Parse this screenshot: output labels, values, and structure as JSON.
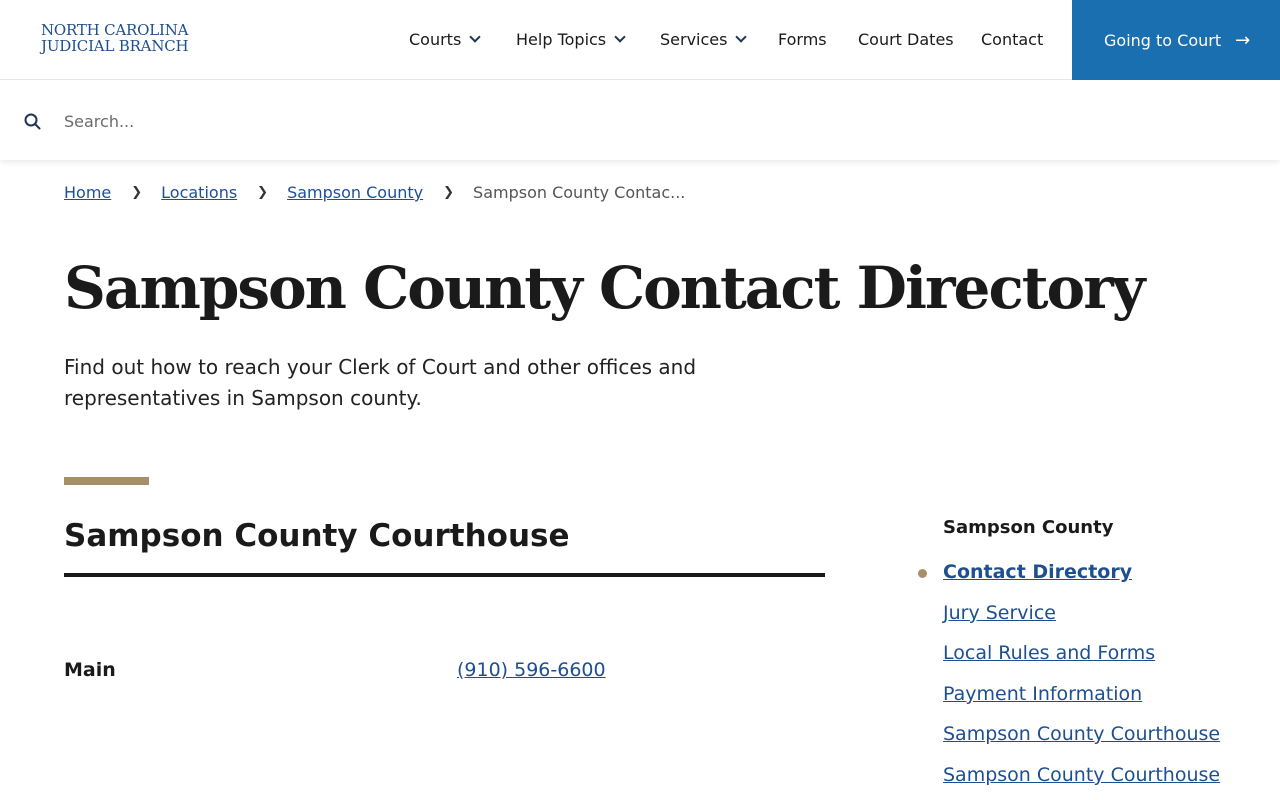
{
  "header": {
    "logo_line1": "NORTH CAROLINA",
    "logo_line2": "JUDICIAL BRANCH",
    "nav": [
      {
        "label": "Courts",
        "has_dropdown": true
      },
      {
        "label": "Help Topics",
        "has_dropdown": true
      },
      {
        "label": "Services",
        "has_dropdown": true
      },
      {
        "label": "Forms",
        "has_dropdown": false
      },
      {
        "label": "Court Dates",
        "has_dropdown": false
      },
      {
        "label": "Contact",
        "has_dropdown": false
      }
    ],
    "cta_label": "Going to Court",
    "cta_color": "#1a6fb0"
  },
  "search": {
    "placeholder": "Search...",
    "value": ""
  },
  "breadcrumb": {
    "items": [
      "Home",
      "Locations",
      "Sampson County"
    ],
    "current": "Sampson County Contac..."
  },
  "page": {
    "title": "Sampson County Contact Directory",
    "intro": "Find out how to reach your Clerk of Court and other offices and representatives in Sampson county."
  },
  "section": {
    "title": "Sampson County Courthouse",
    "accent_color": "#a6906a",
    "contacts": [
      {
        "label": "Main",
        "phone": "(910) 596-6600"
      }
    ]
  },
  "sidebar": {
    "heading": "Sampson County",
    "links": [
      {
        "label": "Contact Directory",
        "active": true
      },
      {
        "label": "Jury Service",
        "active": false
      },
      {
        "label": "Local Rules and Forms",
        "active": false
      },
      {
        "label": "Payment Information",
        "active": false
      },
      {
        "label": "Sampson County Courthouse",
        "active": false
      },
      {
        "label": "Sampson County Courthouse",
        "active": false
      }
    ]
  }
}
